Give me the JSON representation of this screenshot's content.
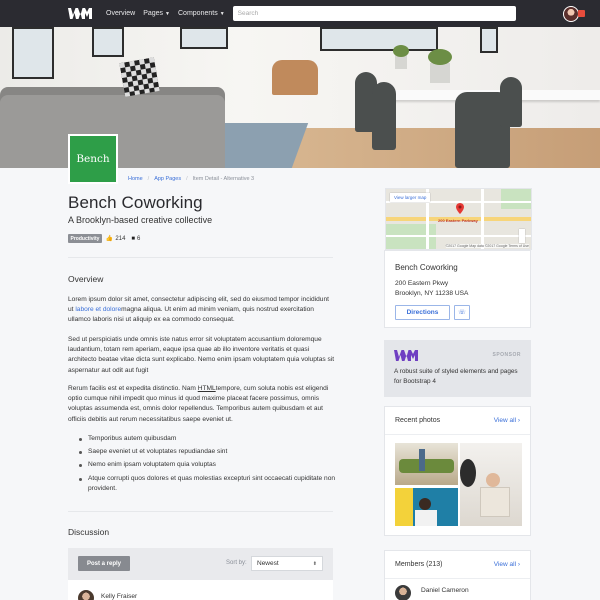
{
  "navbar": {
    "nav_links": [
      "Overview",
      "Pages",
      "Components"
    ],
    "search_placeholder": "Search"
  },
  "breadcrumb": [
    "Home",
    "App Pages",
    "Item Detail - Alternative 3"
  ],
  "brand_logo_text": "Bench",
  "header": {
    "title": "Bench Coworking",
    "subtitle": "A Brooklyn-based creative collective",
    "tag": "Productivity",
    "likes": "214",
    "comments": "6"
  },
  "overview": {
    "title": "Overview",
    "p1_a": "Lorem ipsum dolor sit amet, consectetur adipiscing elit, sed do eiusmod tempor incididunt ut ",
    "p1_link": "labore et dolore",
    "p1_b": "magna aliqua. Ut enim ad minim veniam, quis nostrud exercitation ullamco laboris nisi ut aliquip ex ea commodo consequat.",
    "p2": "Sed ut perspiciatis unde omnis iste natus error sit voluptatem accusantium doloremque laudantium, totam rem aperiam, eaque ipsa quae ab illo inventore veritatis et quasi architecto beatae vitae dicta sunt explicabo. Nemo enim ipsam voluptatem quia voluptas sit aspernatur aut odit aut fugit",
    "p3_a": "Rerum facilis est et expedita distinctio. Nam ",
    "p3_u": "HTML",
    "p3_b": "tempore, cum soluta nobis est eligendi optio cumque nihil impedit quo minus id quod maxime placeat facere possimus, omnis voluptas assumenda est, omnis dolor repellendus. Temporibus autem quibusdam et aut officiis debitis aut rerum necessitatibus saepe eveniet ut.",
    "bullets": [
      "Temporibus autem quibusdam",
      "Saepe eveniet ut et voluptates repudiandae sint",
      "Nemo enim ipsam voluptatem quia voluptas",
      "Atque corrupti quos dolores et quas molestias excepturi sint occaecati cupiditate non provident."
    ]
  },
  "discussion": {
    "title": "Discussion",
    "post_button": "Post a reply",
    "sort_label": "Sort by:",
    "sort_value": "Newest",
    "first_commenter": "Kelly Fraiser"
  },
  "map": {
    "view_larger": "View larger map",
    "pin_label": "200 Eastern Parkway",
    "copyright": "©2017 Google  Map data ©2017 Google  Terms of Use"
  },
  "location": {
    "name": "Bench Coworking",
    "address_line1": "200 Eastern Pkwy",
    "address_line2": "Brooklyn, NY 11238 USA",
    "directions_button": "Directions"
  },
  "sponsor": {
    "label": "SPONSOR",
    "text": "A robust suite of styled elements and pages for Bootstrap 4"
  },
  "recent_photos": {
    "title": "Recent photos",
    "link": "View all ›"
  },
  "members": {
    "title": "Members (213)",
    "link": "View all ›",
    "first_member": "Daniel Cameron"
  },
  "colors": {
    "navbar": "#2b2b31",
    "accent": "#3a6fd8",
    "brand_green": "#2e9e48",
    "sponsor_purple": "#6f3fc2"
  }
}
